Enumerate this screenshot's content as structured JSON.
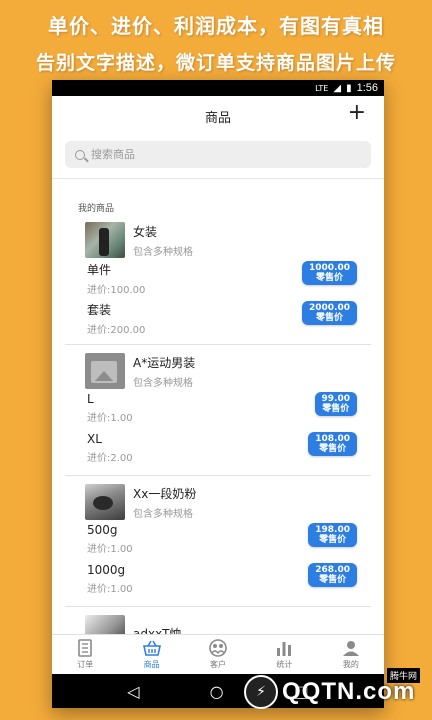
{
  "promo": {
    "line1": "单价、进价、利润成本，有图有真相",
    "line2": "告别文字描述，微订单支持商品图片上传"
  },
  "statusbar": {
    "signal": "LTE",
    "time": "1:56"
  },
  "header": {
    "title": "商品",
    "add": "+"
  },
  "search": {
    "placeholder": "搜索商品"
  },
  "section_label": "我的商品",
  "products": [
    {
      "name": "女装",
      "sub": "包含多种规格",
      "skus": [
        {
          "name": "单件",
          "cost": "进价:100.00",
          "price": "1000.00",
          "price_label": "零售价"
        },
        {
          "name": "套装",
          "cost": "进价:200.00",
          "price": "2000.00",
          "price_label": "零售价"
        }
      ]
    },
    {
      "name": "A*运动男装",
      "sub": "包含多种规格",
      "skus": [
        {
          "name": "L",
          "cost": "进价:1.00",
          "price": "99.00",
          "price_label": "零售价"
        },
        {
          "name": "XL",
          "cost": "进价:2.00",
          "price": "108.00",
          "price_label": "零售价"
        }
      ]
    },
    {
      "name": "Xx一段奶粉",
      "sub": "包含多种规格",
      "skus": [
        {
          "name": "500g",
          "cost": "进价:1.00",
          "price": "198.00",
          "price_label": "零售价"
        },
        {
          "name": "1000g",
          "cost": "进价:1.00",
          "price": "268.00",
          "price_label": "零售价"
        }
      ]
    },
    {
      "name": "adxxT恤"
    }
  ],
  "tabs": [
    {
      "label": "订单",
      "icon": "orders-icon"
    },
    {
      "label": "商品",
      "icon": "basket-icon",
      "active": true
    },
    {
      "label": "客户",
      "icon": "customers-icon"
    },
    {
      "label": "统计",
      "icon": "stats-icon"
    },
    {
      "label": "我的",
      "icon": "profile-icon"
    }
  ],
  "navbar": {
    "back": "◁",
    "home": "○",
    "recent": "□"
  },
  "watermark": {
    "text": "QQTN.com",
    "badge": "腾牛网"
  },
  "colors": {
    "background": "#f3ab3a",
    "accent": "#2d7ee3"
  }
}
